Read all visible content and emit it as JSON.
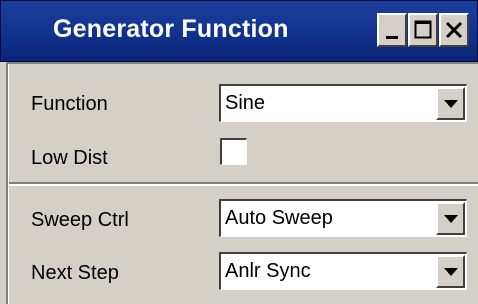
{
  "window": {
    "title": "Generator Function",
    "controls": [
      {
        "name": "minimize-icon"
      },
      {
        "name": "maximize-icon"
      },
      {
        "name": "close-icon"
      }
    ]
  },
  "rows": {
    "function": {
      "label": "Function",
      "value": "Sine"
    },
    "low_dist": {
      "label": "Low Dist",
      "checked": false
    },
    "sweep_ctrl": {
      "label": "Sweep Ctrl",
      "value": "Auto Sweep"
    },
    "next_step": {
      "label": "Next Step",
      "value": "Anlr Sync"
    }
  },
  "colors": {
    "titlebar": "#11318e",
    "face": "#d4d0c8",
    "text_light": "#ffffff"
  }
}
